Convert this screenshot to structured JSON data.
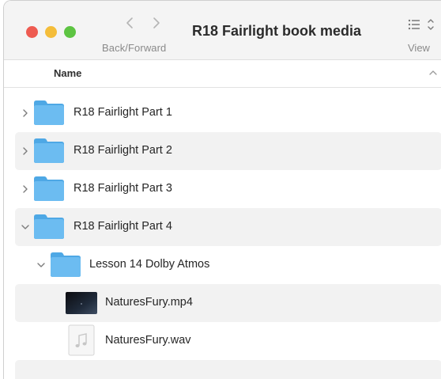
{
  "window": {
    "title": "R18 Fairlight book media",
    "nav_label": "Back/Forward",
    "view_label": "View"
  },
  "colors": {
    "close": "#ee5b51",
    "minimize": "#f4bd3a",
    "zoom": "#5dc442",
    "folder": "#64b8ee"
  },
  "header": {
    "name_label": "Name"
  },
  "rows": [
    {
      "label": "R18 Fairlight Part 1",
      "type": "folder",
      "expanded": false,
      "level": 0
    },
    {
      "label": "R18 Fairlight Part 2",
      "type": "folder",
      "expanded": false,
      "level": 0
    },
    {
      "label": "R18 Fairlight Part 3",
      "type": "folder",
      "expanded": false,
      "level": 0
    },
    {
      "label": "R18 Fairlight Part 4",
      "type": "folder",
      "expanded": true,
      "level": 0
    },
    {
      "label": "Lesson 14 Dolby Atmos",
      "type": "folder",
      "expanded": true,
      "level": 1
    },
    {
      "label": "NaturesFury.mp4",
      "type": "video",
      "level": 2
    },
    {
      "label": "NaturesFury.wav",
      "type": "audio",
      "level": 2
    }
  ]
}
